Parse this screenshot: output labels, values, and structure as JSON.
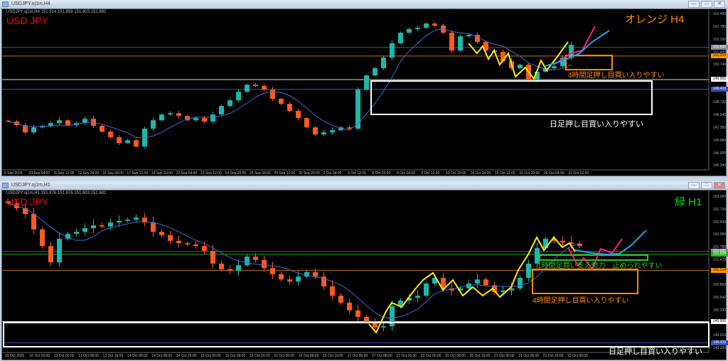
{
  "windows": [
    {
      "title": "USDJPY.oj1m,H4",
      "info": "USDJPY.oj1m,H4  151.914 151.959 151.603 151.682",
      "symbol": "USD JPY",
      "tf_label": "オレンジ H4"
    },
    {
      "title": "USDJPY.oj1m,H1",
      "info": "USDJPY.oj1m,H1  151.876 151.876 151.603 151.682",
      "symbol": "USD JPY",
      "tf_label": "緑 H1"
    }
  ],
  "window_buttons": {
    "minimize": "—",
    "maximize": "□",
    "close": "✕"
  },
  "colors": {
    "up": "#1fb8a8",
    "down": "#ff5a1f",
    "ma": "#4d63d6",
    "orange": "#ff8c00",
    "green": "#22cc22",
    "white": "#ffffff",
    "blue": "#3050c0",
    "yellow": "#ffee00",
    "pink": "#ff1c8c",
    "cyan": "#1ca6e8"
  },
  "annotations": {
    "top": {
      "daily": "日足押し目買い入りやすい",
      "h4": "4時間足押し目買い入りやすい"
    },
    "bottom": {
      "daily": "日足押し目買い入りやすい",
      "h1": "1時間足買い支え勢力　止められやすい",
      "h4": "4時間足押し目買い入りやすい"
    }
  },
  "chart_data": [
    {
      "type": "candlestick",
      "title": "USDJPY.oj1m,H4",
      "ylim": [
        145.34,
        153.46
      ],
      "yticks": [
        "153.460",
        "152.780",
        "152.100",
        "151.420",
        "150.740",
        "148.720",
        "148.040",
        "147.360",
        "146.680",
        "146.000",
        "145.340"
      ],
      "price_boxes": [
        {
          "text": "151.682",
          "color": "#8090a0"
        },
        {
          "text": "151.214",
          "color": "#ff9900"
        },
        {
          "text": "149.955",
          "color": "#ffffff"
        },
        {
          "text": "149.433",
          "color": "#3050c0"
        }
      ],
      "xticks": [
        "8 Sep 2025",
        "10 Sep 04:00",
        "11 Sep 12:00",
        "12 Sep 20:00",
        "16 Sep 04:00",
        "17 Sep 12:00",
        "18 Sep 20:00",
        "22 Sep 04:00",
        "23 Sep 12:00",
        "24 Sep 20:00",
        "26 Sep 04:00",
        "29 Sep 12:00",
        "30 Sep 20:00",
        "2 Oct 04:00",
        "3 Oct 12:00",
        "6 Oct 20:00",
        "8 Oct 04:00",
        "9 Oct 12:00",
        "10 Oct 20:00",
        "14 Oct 04:00",
        "15 Oct 12:00",
        "16 Oct 20:00",
        "20 Oct 04:00",
        "21 Oct 12:00"
      ],
      "close": [
        147.7,
        147.51,
        147.12,
        147.39,
        147.47,
        147.62,
        147.77,
        147.51,
        147.62,
        147.85,
        147.47,
        147.16,
        146.86,
        146.55,
        146.7,
        146.36,
        147.32,
        147.77,
        148.08,
        148.15,
        148.0,
        147.77,
        147.89,
        147.7,
        148.08,
        148.54,
        148.84,
        149.3,
        149.68,
        149.61,
        149.41,
        148.92,
        148.65,
        148.27,
        147.89,
        147.39,
        147.01,
        147.12,
        147.24,
        147.39,
        147.32,
        149.41,
        150.18,
        150.56,
        151.13,
        151.9,
        152.47,
        152.66,
        152.73,
        152.96,
        152.85,
        152.47,
        151.51,
        152.28,
        152.35,
        151.97,
        151.51,
        151.44,
        150.94,
        150.56,
        150.75,
        149.91,
        150.37,
        150.56,
        150.67,
        151.13,
        151.82
      ],
      "hlines": [
        {
          "price": 151.682,
          "color": "#555"
        },
        {
          "price": 151.214,
          "color": "#c07000"
        },
        {
          "price": 149.955,
          "color": "#ddd"
        },
        {
          "price": 149.433,
          "color": "#3050c0"
        }
      ]
    },
    {
      "type": "candlestick",
      "title": "USDJPY.oj1m,H1",
      "ylim": [
        149.3,
        153.02
      ],
      "yticks": [
        "153.020",
        "152.710",
        "152.400",
        "152.090",
        "151.780",
        "151.470",
        "150.850",
        "150.540",
        "150.230",
        "149.610",
        "149.300"
      ],
      "price_boxes": [
        {
          "text": "151.682",
          "color": "#8090a0"
        },
        {
          "text": "151.608",
          "color": "#22bb22"
        },
        {
          "text": "151.214",
          "color": "#ff9900"
        },
        {
          "text": "149.955",
          "color": "#ffffff"
        },
        {
          "text": "149.433",
          "color": "#3050c0"
        }
      ],
      "xticks": [
        "10 Oct 2025",
        "10 Oct 16:00",
        "13 Oct 00:00",
        "13 Oct 08:00",
        "13 Oct 16:00",
        "14 Oct 00:00",
        "14 Oct 08:00",
        "14 Oct 16:00",
        "15 Oct 00:00",
        "15 Oct 08:00",
        "15 Oct 16:00",
        "16 Oct 00:00",
        "16 Oct 08:00",
        "16 Oct 16:00",
        "17 Oct 00:00",
        "17 Oct 08:00",
        "17 Oct 16:00",
        "20 Oct 00:00",
        "20 Oct 08:00",
        "20 Oct 16:00",
        "21 Oct 00:00",
        "21 Oct 08:00",
        "21 Oct 16:00",
        "22 Oct 00:00"
      ],
      "close": [
        152.86,
        152.74,
        152.6,
        152.22,
        151.81,
        151.41,
        151.99,
        152.11,
        152.16,
        152.25,
        152.32,
        152.29,
        152.39,
        152.43,
        152.46,
        152.51,
        152.39,
        152.16,
        152.08,
        151.94,
        151.88,
        151.85,
        151.81,
        151.69,
        151.38,
        151.24,
        151.2,
        151.34,
        151.55,
        151.47,
        151.27,
        151.12,
        150.99,
        150.94,
        151.06,
        151.17,
        151.06,
        150.82,
        150.59,
        150.42,
        150.23,
        150.07,
        149.95,
        149.81,
        149.84,
        150.33,
        150.47,
        150.54,
        150.59,
        150.89,
        151.03,
        150.77,
        150.72,
        150.77,
        150.89,
        150.99,
        150.85,
        150.68,
        150.72,
        150.77,
        151.03,
        151.38,
        151.76,
        151.99,
        151.94,
        151.9,
        151.87,
        151.81
      ],
      "hlines": [
        {
          "price": 151.682,
          "color": "#555"
        },
        {
          "price": 151.608,
          "color": "#22aa22"
        },
        {
          "price": 151.214,
          "color": "#c07000"
        },
        {
          "price": 149.955,
          "color": "#ddd"
        },
        {
          "price": 149.433,
          "color": "#3050c0"
        }
      ]
    }
  ]
}
